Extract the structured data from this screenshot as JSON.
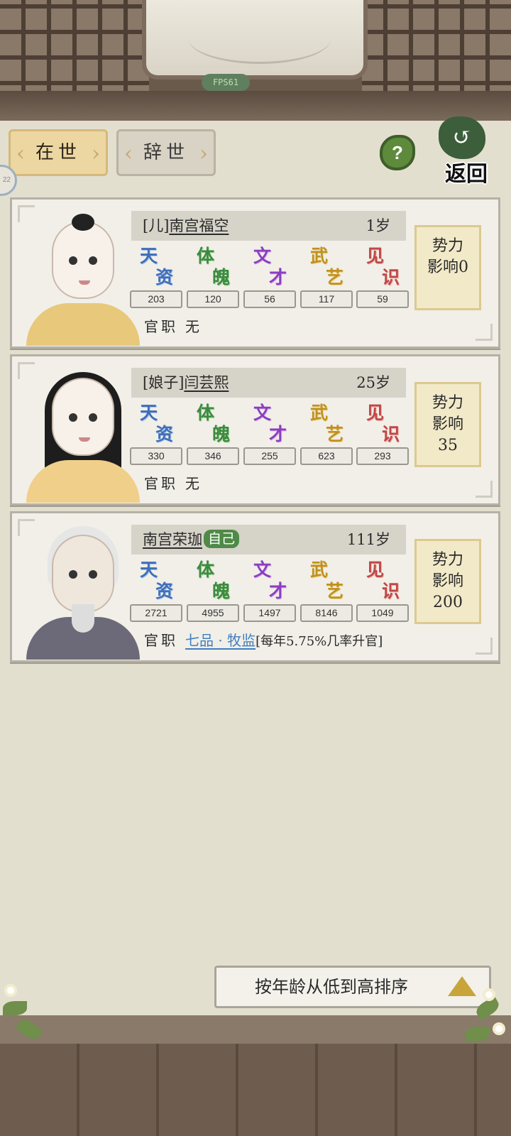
{
  "header": {
    "fps": "FPS61",
    "tabs": [
      {
        "label": "在世",
        "active": true
      },
      {
        "label": "辞世",
        "active": false
      }
    ],
    "help_label": "?",
    "back_label": "返回",
    "side_badge": "22"
  },
  "attributes": [
    "天资",
    "体魄",
    "文才",
    "武艺",
    "见识"
  ],
  "members": [
    {
      "role": "[儿]",
      "name": "南宫福空",
      "age": "1岁",
      "stats": [
        "203",
        "120",
        "56",
        "117",
        "59"
      ],
      "office_label": "官职",
      "office": "无",
      "influence_lines": [
        "势力",
        "影响0"
      ]
    },
    {
      "role": "[娘子]",
      "name": "闫芸熙",
      "age": "25岁",
      "stats": [
        "330",
        "346",
        "255",
        "623",
        "293"
      ],
      "office_label": "官职",
      "office": "无",
      "influence_lines": [
        "势力",
        "影响",
        "35"
      ]
    },
    {
      "name": "南宫荣珈",
      "self_tag": "自己",
      "age": "111岁",
      "stats": [
        "2721",
        "4955",
        "1497",
        "8146",
        "1049"
      ],
      "office_label": "官职",
      "office": "七品 · 牧监",
      "office_note": "[每年5.75%几率升官]",
      "influence_lines": [
        "势力",
        "影响",
        "200"
      ]
    }
  ],
  "sort_button": {
    "label": "按年龄从低到高排序",
    "direction": "ascending"
  },
  "colors": {
    "tab_active": "#ecd6a1",
    "tian": "#3f6fb8",
    "ti": "#3d8a40",
    "wen": "#8b3ec0",
    "wu": "#c09020",
    "jian": "#c04848",
    "self_tag": "#4f8a47",
    "office_link": "#3f7fc0"
  }
}
